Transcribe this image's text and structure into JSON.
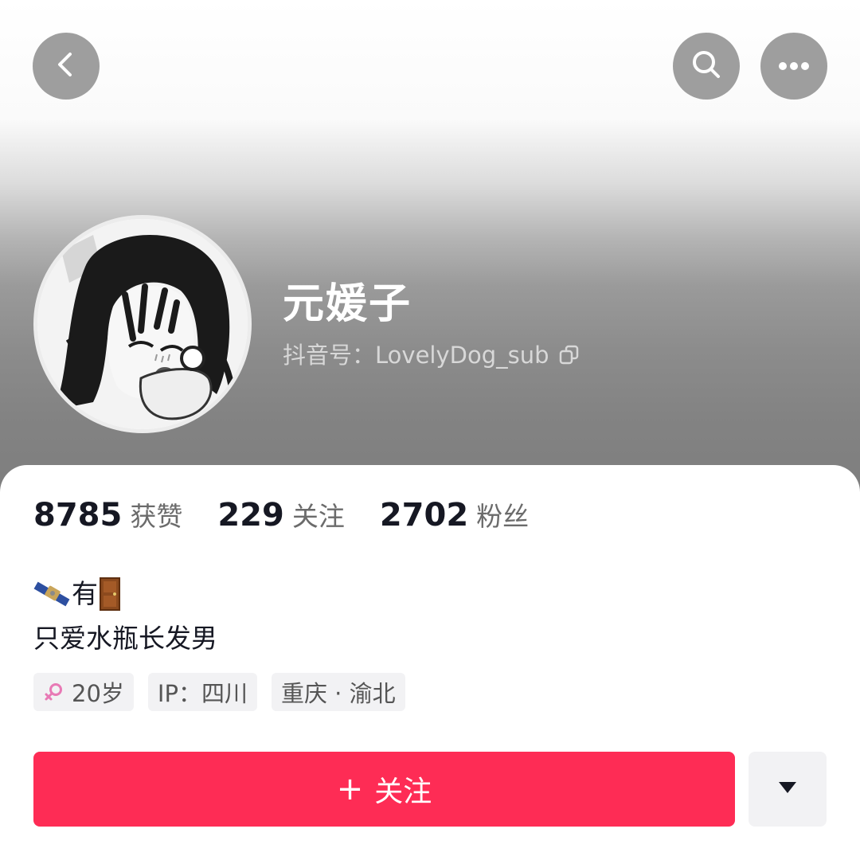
{
  "profile": {
    "nickname": "元媛子",
    "douyin_id_label": "抖音号：",
    "douyin_id": "LovelyDog_sub"
  },
  "stats": [
    {
      "value": "8785",
      "label": "获赞"
    },
    {
      "value": "229",
      "label": "关注"
    },
    {
      "value": "2702",
      "label": "粉丝"
    }
  ],
  "bio": {
    "line1_text": "有",
    "line2": "只爱水瓶长发男"
  },
  "tags": {
    "age": "20岁",
    "ip": "IP：四川",
    "location": "重庆 · 渝北"
  },
  "actions": {
    "follow_plus": "+",
    "follow_label": "关注"
  },
  "icons": {
    "back": "chevron-left-icon",
    "search": "search-icon",
    "more": "more-dots-icon",
    "copy": "copy-icon",
    "gender": "female-icon",
    "dropdown": "triangle-down-icon",
    "bio_emoji_1": "satellite-emoji",
    "bio_emoji_2": "door-emoji"
  },
  "colors": {
    "accent": "#fe2c55",
    "nav_button": "#9e9e9e",
    "gender_icon": "#e879b5"
  }
}
